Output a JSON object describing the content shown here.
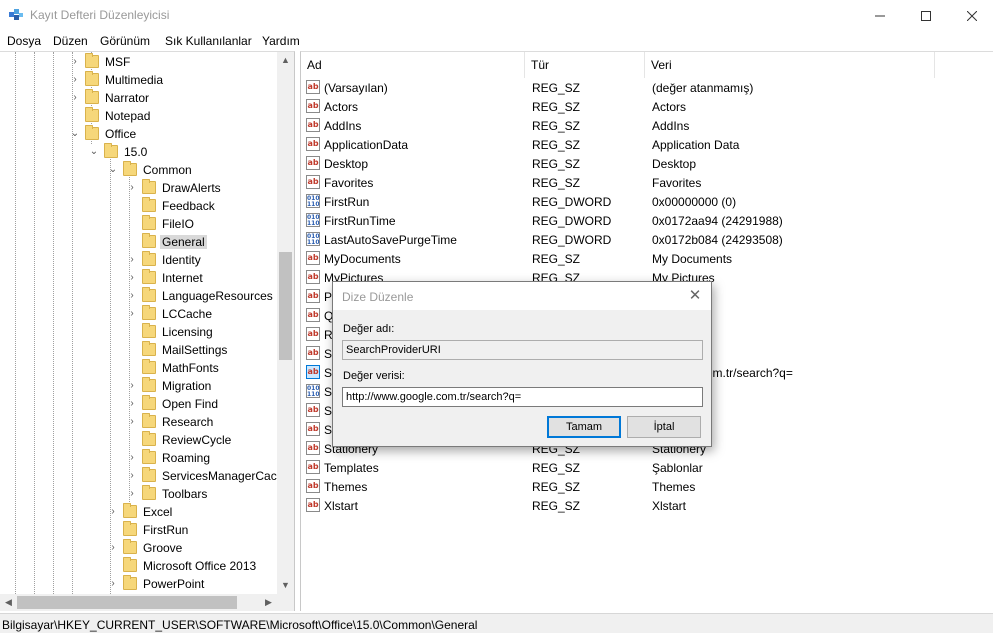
{
  "window": {
    "title": "Kayıt Defteri Düzenleyicisi",
    "icons": {
      "app": "regedit-icon",
      "minimize": "minimize-icon",
      "maximize": "maximize-icon",
      "close": "close-icon"
    }
  },
  "menu": {
    "items": [
      "Dosya",
      "Düzen",
      "Görünüm",
      "Sık Kullanılanlar",
      "Yardım"
    ]
  },
  "tree": {
    "items": [
      {
        "label": "MSF",
        "expander": "collapsed",
        "selected": false
      },
      {
        "label": "Multimedia",
        "expander": "collapsed",
        "selected": false
      },
      {
        "label": "Narrator",
        "expander": "collapsed",
        "selected": false
      },
      {
        "label": "Notepad",
        "expander": "none",
        "selected": false
      },
      {
        "label": "Office",
        "expander": "expanded",
        "selected": false
      },
      {
        "label": "15.0",
        "expander": "expanded",
        "selected": false
      },
      {
        "label": "Common",
        "expander": "expanded",
        "selected": false
      },
      {
        "label": "DrawAlerts",
        "expander": "collapsed",
        "selected": false
      },
      {
        "label": "Feedback",
        "expander": "none",
        "selected": false
      },
      {
        "label": "FileIO",
        "expander": "none",
        "selected": false
      },
      {
        "label": "General",
        "expander": "none",
        "selected": true
      },
      {
        "label": "Identity",
        "expander": "collapsed",
        "selected": false
      },
      {
        "label": "Internet",
        "expander": "collapsed",
        "selected": false
      },
      {
        "label": "LanguageResources",
        "expander": "collapsed",
        "selected": false
      },
      {
        "label": "LCCache",
        "expander": "collapsed",
        "selected": false
      },
      {
        "label": "Licensing",
        "expander": "none",
        "selected": false
      },
      {
        "label": "MailSettings",
        "expander": "none",
        "selected": false
      },
      {
        "label": "MathFonts",
        "expander": "none",
        "selected": false
      },
      {
        "label": "Migration",
        "expander": "collapsed",
        "selected": false
      },
      {
        "label": "Open Find",
        "expander": "collapsed",
        "selected": false
      },
      {
        "label": "Research",
        "expander": "collapsed",
        "selected": false
      },
      {
        "label": "ReviewCycle",
        "expander": "none",
        "selected": false
      },
      {
        "label": "Roaming",
        "expander": "collapsed",
        "selected": false
      },
      {
        "label": "ServicesManagerCache",
        "expander": "collapsed",
        "selected": false
      },
      {
        "label": "Toolbars",
        "expander": "collapsed",
        "selected": false
      },
      {
        "label": "Excel",
        "expander": "collapsed",
        "selected": false
      },
      {
        "label": "FirstRun",
        "expander": "none",
        "selected": false
      },
      {
        "label": "Groove",
        "expander": "collapsed",
        "selected": false
      },
      {
        "label": "Microsoft Office 2013",
        "expander": "none",
        "selected": false
      },
      {
        "label": "PowerPoint",
        "expander": "collapsed",
        "selected": false
      }
    ]
  },
  "list": {
    "columns": [
      "Ad",
      "Tür",
      "Veri"
    ],
    "rows": [
      {
        "name": "(Varsayılan)",
        "type": "REG_SZ",
        "data": "(değer atanmamış)",
        "icon": "string-value-icon"
      },
      {
        "name": "Actors",
        "type": "REG_SZ",
        "data": "Actors",
        "icon": "string-value-icon"
      },
      {
        "name": "AddIns",
        "type": "REG_SZ",
        "data": "AddIns",
        "icon": "string-value-icon"
      },
      {
        "name": "ApplicationData",
        "type": "REG_SZ",
        "data": "Application Data",
        "icon": "string-value-icon"
      },
      {
        "name": "Desktop",
        "type": "REG_SZ",
        "data": "Desktop",
        "icon": "string-value-icon"
      },
      {
        "name": "Favorites",
        "type": "REG_SZ",
        "data": "Favorites",
        "icon": "string-value-icon"
      },
      {
        "name": "FirstRun",
        "type": "REG_DWORD",
        "data": "0x00000000 (0)",
        "icon": "dword-value-icon"
      },
      {
        "name": "FirstRunTime",
        "type": "REG_DWORD",
        "data": "0x0172aa94 (24291988)",
        "icon": "dword-value-icon"
      },
      {
        "name": "LastAutoSavePurgeTime",
        "type": "REG_DWORD",
        "data": "0x0172b084 (24293508)",
        "icon": "dword-value-icon"
      },
      {
        "name": "MyDocuments",
        "type": "REG_SZ",
        "data": "My Documents",
        "icon": "string-value-icon"
      },
      {
        "name": "MyPictures",
        "type": "REG_SZ",
        "data": "My Pictures",
        "icon": "string-value-icon"
      },
      {
        "name": "Pr",
        "type": "",
        "data": "",
        "icon": "string-value-icon"
      },
      {
        "name": "Q",
        "type": "",
        "data": "",
        "icon": "string-value-icon"
      },
      {
        "name": "Re",
        "type": "",
        "data": "",
        "icon": "string-value-icon"
      },
      {
        "name": "Se",
        "type": "",
        "data": "",
        "icon": "string-value-icon"
      },
      {
        "name": "Se",
        "type": "",
        "data": "v.google.com.tr/search?q=",
        "icon": "string-value-icon-selected"
      },
      {
        "name": "Sk",
        "type": "",
        "data": "(1)",
        "icon": "dword-value-icon"
      },
      {
        "name": "Si",
        "type": "",
        "data": "",
        "icon": "string-value-icon"
      },
      {
        "name": "St",
        "type": "",
        "data": "",
        "icon": "string-value-icon"
      },
      {
        "name": "Stationery",
        "type": "REG_SZ",
        "data": "Stationery",
        "icon": "string-value-icon"
      },
      {
        "name": "Templates",
        "type": "REG_SZ",
        "data": "Şablonlar",
        "icon": "string-value-icon"
      },
      {
        "name": "Themes",
        "type": "REG_SZ",
        "data": "Themes",
        "icon": "string-value-icon"
      },
      {
        "name": "Xlstart",
        "type": "REG_SZ",
        "data": "Xlstart",
        "icon": "string-value-icon"
      }
    ]
  },
  "dialog": {
    "title": "Dize Düzenle",
    "name_label": "Değer adı:",
    "name_value": "SearchProviderURI",
    "data_label": "Değer verisi:",
    "data_value": "http://www.google.com.tr/search?q=",
    "ok_label": "Tamam",
    "cancel_label": "İptal"
  },
  "status": {
    "path": "Bilgisayar\\HKEY_CURRENT_USER\\SOFTWARE\\Microsoft\\Office\\15.0\\Common\\General"
  },
  "colors": {
    "folder": "#f6d77a",
    "selection": "#d9d9d9",
    "accent": "#0078d7",
    "string_icon": "#c0392b",
    "binary_icon": "#2a5db0"
  }
}
